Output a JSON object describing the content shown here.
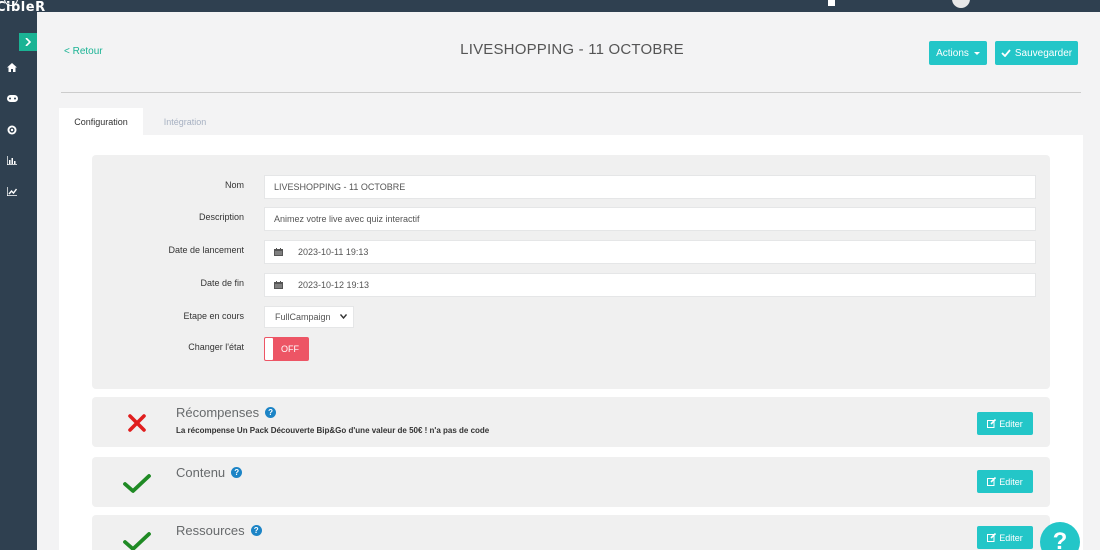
{
  "app": {
    "logo_text": "CibleR"
  },
  "page": {
    "back_label": "< Retour",
    "title": "LIVESHOPPING - 11 OCTOBRE"
  },
  "toolbar": {
    "actions_label": "Actions",
    "save_label": "Sauvegarder"
  },
  "tabs": [
    {
      "label": "Configuration"
    },
    {
      "label": "Intégration"
    }
  ],
  "form": {
    "name": {
      "label": "Nom",
      "value": "LIVESHOPPING - 11 OCTOBRE"
    },
    "description": {
      "label": "Description",
      "value": "Animez votre live avec quiz interactif"
    },
    "start_date": {
      "label": "Date de lancement",
      "value": "2023-10-11 19:13"
    },
    "end_date": {
      "label": "Date de fin",
      "value": "2023-10-12 19:13"
    },
    "step": {
      "label": "Etape en cours",
      "value": "FullCampaign"
    },
    "state": {
      "label": "Changer l'état",
      "value": "OFF"
    }
  },
  "sections": [
    {
      "title": "Récompenses",
      "status": "error",
      "message": "La récompense Un Pack Découverte Bip&Go d'une valeur de 50€ ! n'a pas de code",
      "edit_label": "Editer"
    },
    {
      "title": "Contenu",
      "status": "ok",
      "message": "",
      "edit_label": "Editer"
    },
    {
      "title": "Ressources",
      "status": "ok",
      "message": "",
      "edit_label": "Editer"
    }
  ],
  "help": {
    "label": "?"
  },
  "colors": {
    "sidebar": "#2f4050",
    "accent": "#23c6c8",
    "success": "#1ab394",
    "danger": "#ed5565",
    "error_mark": "#e01e1e",
    "ok_mark": "#1f8a24"
  }
}
